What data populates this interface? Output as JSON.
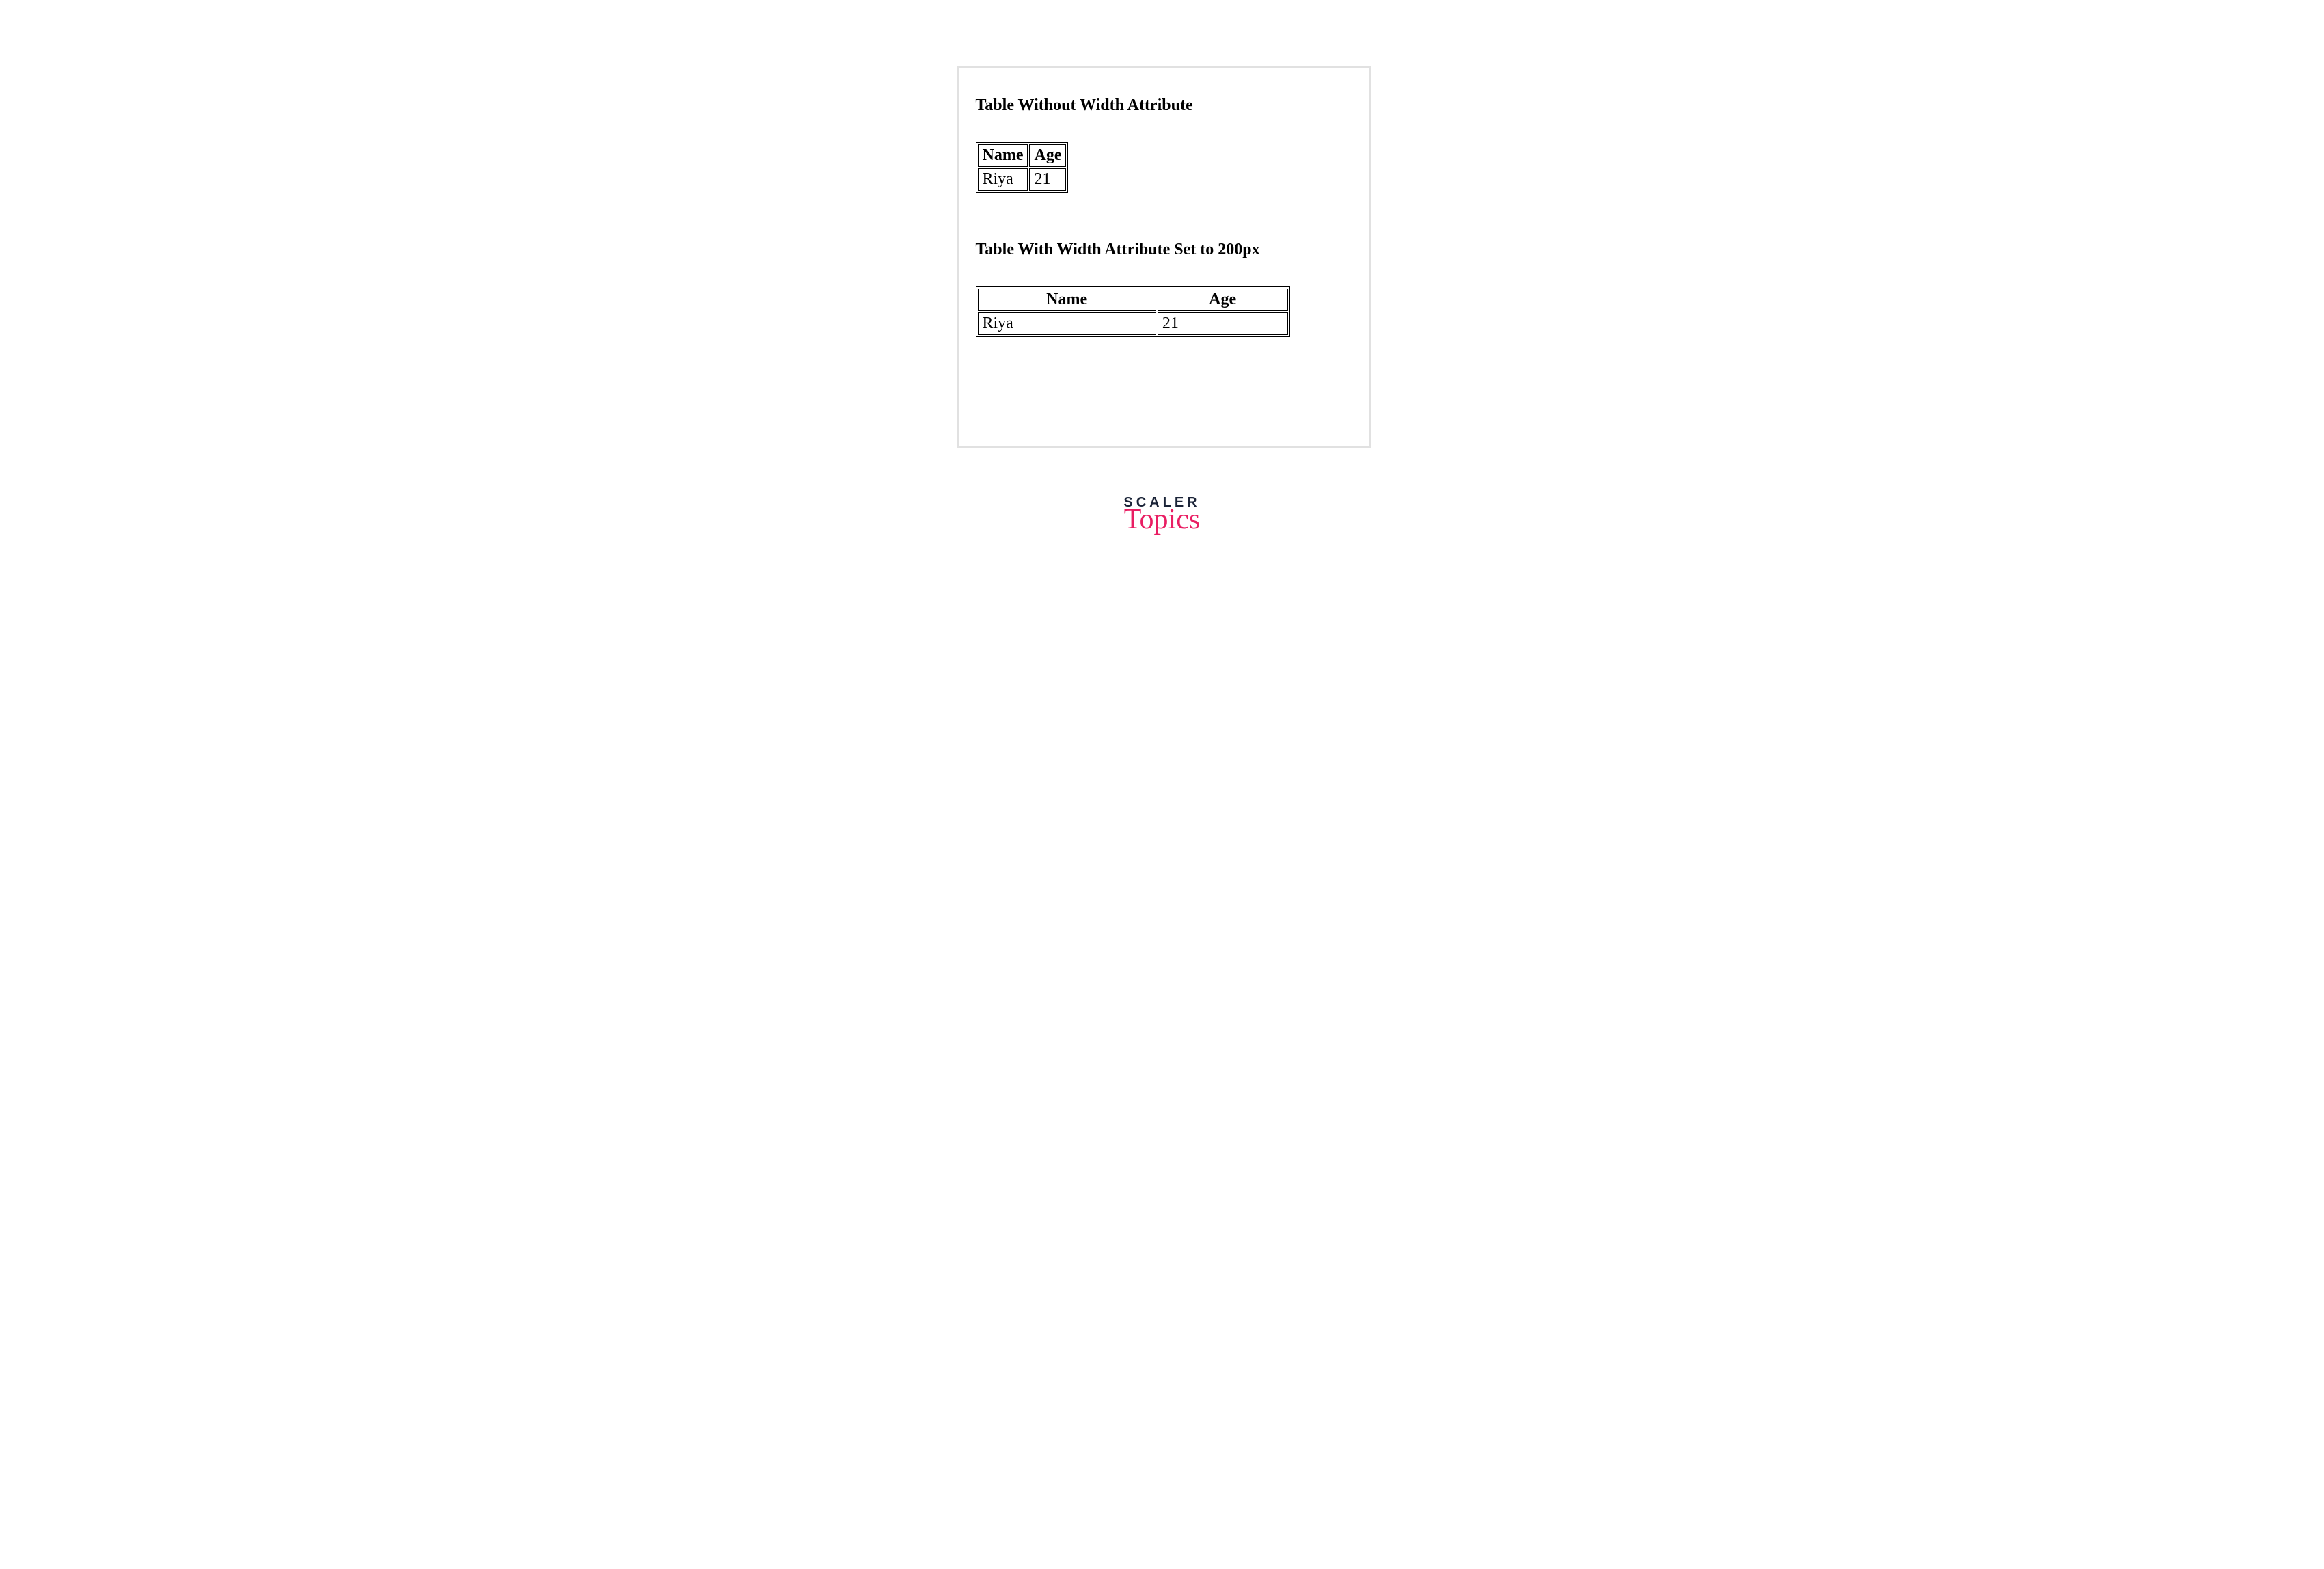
{
  "card": {
    "heading1": "Table Without Width Attribute",
    "heading2": "Table With Width Attribute Set to 200px",
    "table1": {
      "headers": [
        "Name",
        "Age"
      ],
      "row": [
        "Riya",
        "21"
      ]
    },
    "table2": {
      "headers": [
        "Name",
        "Age"
      ],
      "row": [
        "Riya",
        "21"
      ]
    }
  },
  "logo": {
    "line1": "SCALER",
    "line2": "Topics"
  }
}
